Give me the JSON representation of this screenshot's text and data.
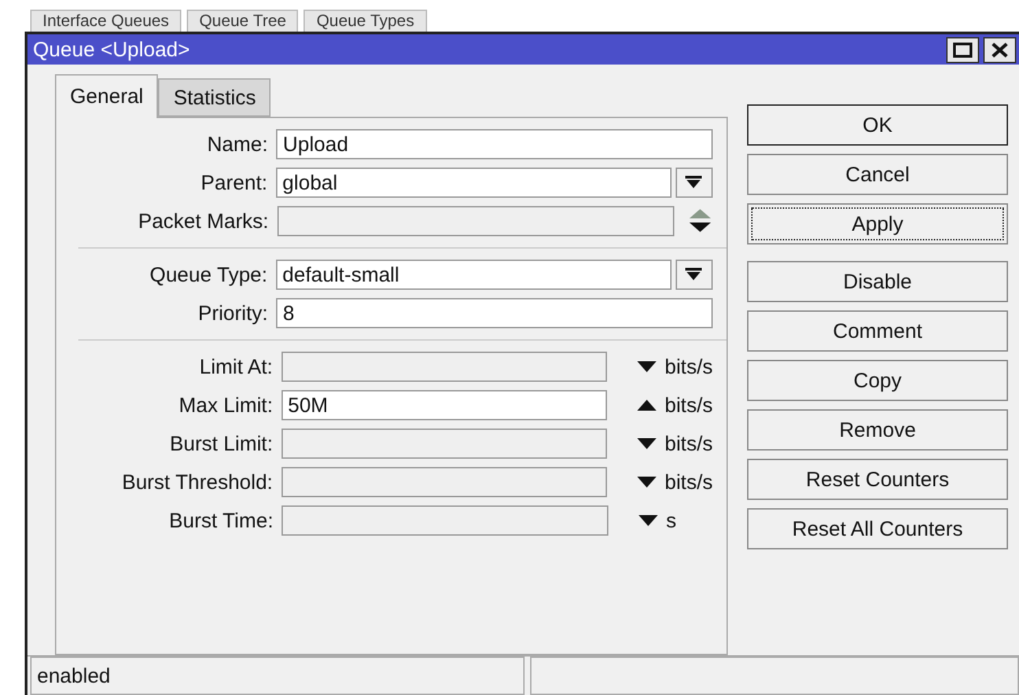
{
  "background_tabs": [
    "Interface Queues",
    "Queue Tree",
    "Queue Types"
  ],
  "window": {
    "title": "Queue <Upload>"
  },
  "tabs": [
    {
      "label": "General",
      "selected": true
    },
    {
      "label": "Statistics",
      "selected": false
    }
  ],
  "groups": [
    {
      "fields": [
        {
          "label": "Name:",
          "kind": "text",
          "value": "Upload",
          "enabled": true
        },
        {
          "label": "Parent:",
          "kind": "combo",
          "value": "global",
          "enabled": true
        },
        {
          "label": "Packet Marks:",
          "kind": "multi",
          "enabled": false
        }
      ]
    },
    {
      "fields": [
        {
          "label": "Queue Type:",
          "kind": "combo",
          "value": "default-small",
          "enabled": true
        },
        {
          "label": "Priority:",
          "kind": "text",
          "value": "8",
          "enabled": true
        }
      ]
    },
    {
      "fields": [
        {
          "label": "Limit At:",
          "kind": "limit",
          "enabled": false,
          "expanded": false,
          "unit": "bits/s"
        },
        {
          "label": "Max Limit:",
          "kind": "limit",
          "value": "50M",
          "enabled": true,
          "expanded": true,
          "unit": "bits/s"
        },
        {
          "label": "Burst Limit:",
          "kind": "limit",
          "enabled": false,
          "expanded": false,
          "unit": "bits/s"
        },
        {
          "label": "Burst Threshold:",
          "kind": "limit",
          "enabled": false,
          "expanded": false,
          "unit": "bits/s"
        },
        {
          "label": "Burst Time:",
          "kind": "limit",
          "enabled": false,
          "expanded": false,
          "unit": "s"
        }
      ]
    }
  ],
  "buttons": [
    {
      "label": "OK",
      "default": true,
      "focused": false
    },
    {
      "label": "Cancel",
      "default": false,
      "focused": false
    },
    {
      "label": "Apply",
      "default": false,
      "focused": true
    },
    {
      "label": "Disable",
      "default": false,
      "focused": false,
      "gap_before": true
    },
    {
      "label": "Comment",
      "default": false,
      "focused": false
    },
    {
      "label": "Copy",
      "default": false,
      "focused": false
    },
    {
      "label": "Remove",
      "default": false,
      "focused": false
    },
    {
      "label": "Reset Counters",
      "default": false,
      "focused": false
    },
    {
      "label": "Reset All Counters",
      "default": false,
      "focused": false
    }
  ],
  "status_bar": [
    "enabled"
  ]
}
